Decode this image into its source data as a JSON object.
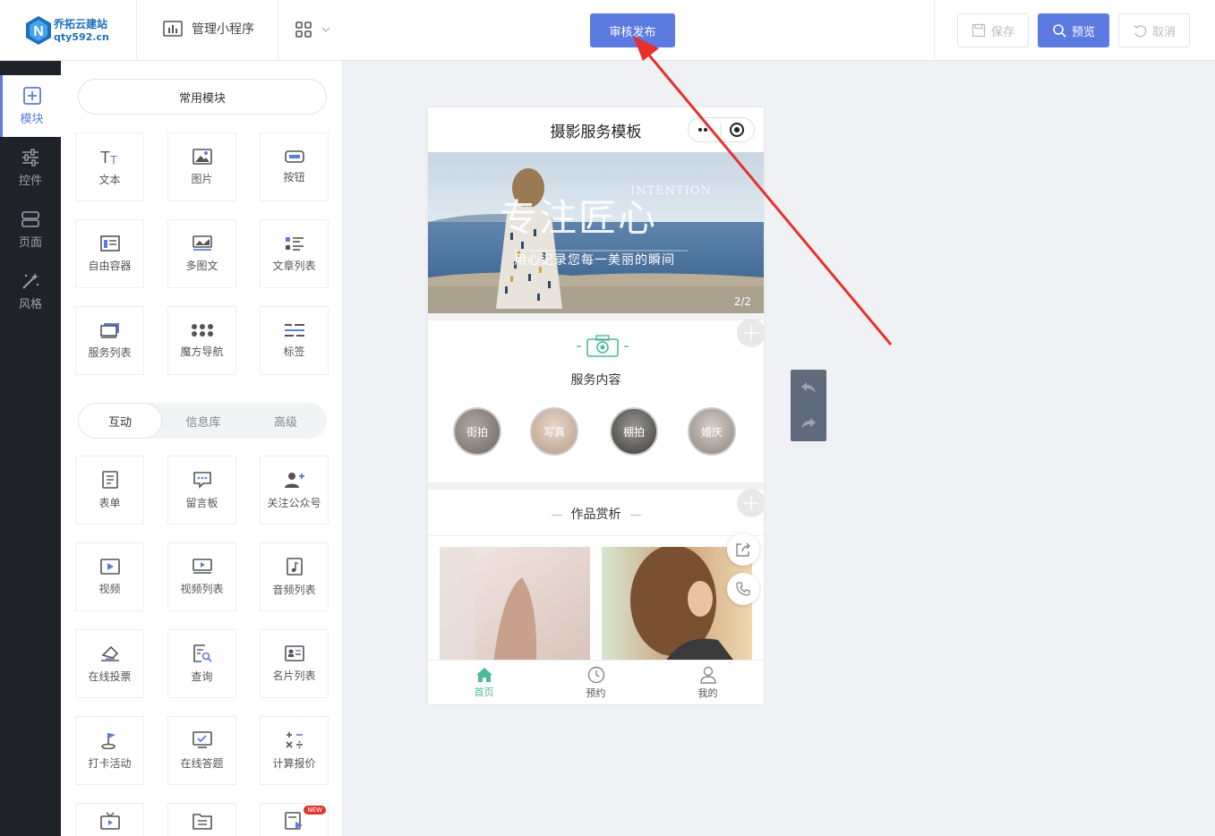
{
  "topbar": {
    "logo_cn": "乔拓云建站",
    "logo_en": "qty592.cn",
    "manage_label": "管理小程序",
    "publish_label": "审核发布",
    "save_label": "保存",
    "preview_label": "预览",
    "cancel_label": "取消"
  },
  "leftnav": {
    "items": [
      {
        "label": "模块",
        "icon": "plus-square-icon"
      },
      {
        "label": "控件",
        "icon": "sliders-icon"
      },
      {
        "label": "页面",
        "icon": "pages-icon"
      },
      {
        "label": "风格",
        "icon": "magic-wand-icon"
      }
    ]
  },
  "panel": {
    "common_title": "常用模块",
    "common_modules": [
      "文本",
      "图片",
      "按钮",
      "自由容器",
      "多图文",
      "文章列表",
      "服务列表",
      "魔方导航",
      "标签"
    ],
    "tabs": [
      "互动",
      "信息库",
      "高级"
    ],
    "interactive_modules": [
      "表单",
      "留言板",
      "关注公众号",
      "视频",
      "视频列表",
      "音频列表",
      "在线投票",
      "查询",
      "名片列表",
      "打卡活动",
      "在线答题",
      "计算报价"
    ],
    "new_badge": "NEW"
  },
  "phone": {
    "title": "摄影服务模板",
    "banner": {
      "headline": "专注匠心",
      "tag": "INTENTION",
      "subline": "用心记录您每一美丽的瞬间",
      "page": "2/2"
    },
    "service_title": "服务内容",
    "services": [
      "街拍",
      "写真",
      "棚拍",
      "婚庆"
    ],
    "works_title": "作品赏析",
    "tabbar": [
      "首页",
      "预约",
      "我的"
    ]
  },
  "colors": {
    "accent": "#5b7be0",
    "nav_bg": "#1f2329",
    "teal": "#4bb99a",
    "arrow": "#e8302c"
  }
}
